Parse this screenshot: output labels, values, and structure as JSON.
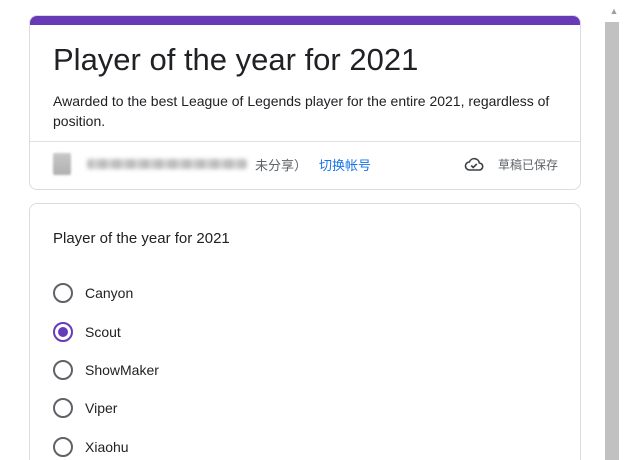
{
  "form": {
    "title": "Player of the year for 2021",
    "description": "Awarded to the best League of Legends player for the entire 2021, regardless of position.",
    "accent_color": "#673ab7"
  },
  "account": {
    "email_suffix": "未分享）",
    "switch_label": "切换帐号",
    "saved_status": "草稿已保存"
  },
  "question": {
    "title": "Player of the year for 2021",
    "selected": "Scout",
    "options": [
      {
        "label": "Canyon",
        "checked": false
      },
      {
        "label": "Scout",
        "checked": true
      },
      {
        "label": "ShowMaker",
        "checked": false
      },
      {
        "label": "Viper",
        "checked": false
      },
      {
        "label": "Xiaohu",
        "checked": false
      }
    ]
  },
  "icons": {
    "cloud": "cloud-saved-icon",
    "scroll_up": "scroll-up-arrow-icon"
  },
  "colors": {
    "link": "#1a73e8",
    "radio_checked": "#673ab7"
  }
}
